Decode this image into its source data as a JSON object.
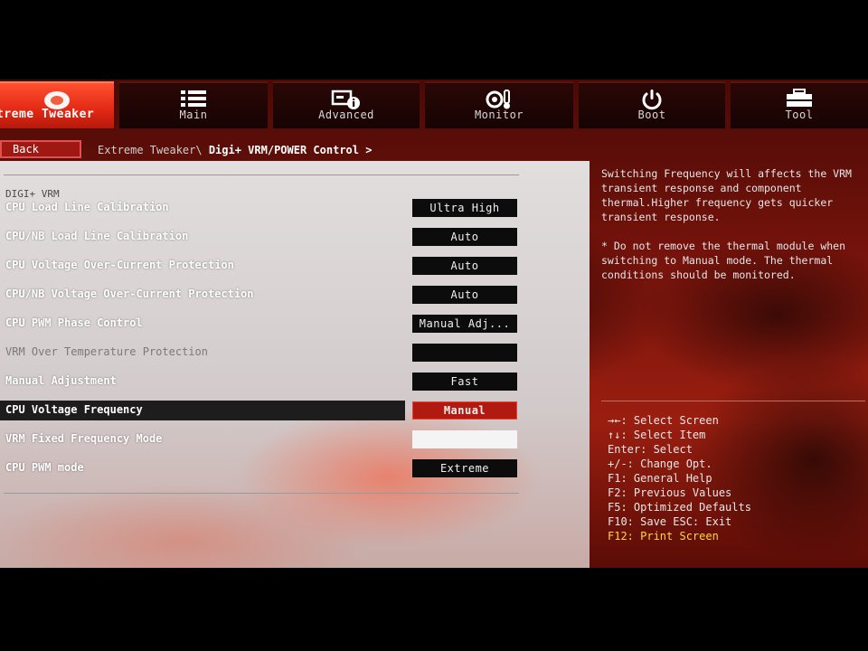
{
  "tabs": [
    {
      "label": "treme Tweaker",
      "icon": "gear-tweaker-icon",
      "active": true
    },
    {
      "label": "Main",
      "icon": "list-icon"
    },
    {
      "label": "Advanced",
      "icon": "advanced-info-icon"
    },
    {
      "label": "Monitor",
      "icon": "thermometer-gear-icon"
    },
    {
      "label": "Boot",
      "icon": "power-icon"
    },
    {
      "label": "Tool",
      "icon": "toolbox-icon"
    }
  ],
  "nav": {
    "back_label": "Back",
    "crumb_path": "Extreme Tweaker\\ ",
    "crumb_current": "Digi+ VRM/POWER Control >"
  },
  "section_title": "DIGI+ VRM",
  "settings": [
    {
      "label": "CPU Load Line Calibration",
      "value": "Ultra High"
    },
    {
      "label": "CPU/NB Load Line Calibration",
      "value": "Auto"
    },
    {
      "label": "CPU Voltage Over-Current Protection",
      "value": "Auto"
    },
    {
      "label": "CPU/NB Voltage Over-Current Protection",
      "value": "Auto"
    },
    {
      "label": "CPU PWM Phase Control",
      "value": "Manual Adj..."
    },
    {
      "label": "VRM Over Temperature Protection",
      "value": ""
    },
    {
      "label": "Manual Adjustment",
      "value": "Fast"
    },
    {
      "label": "CPU Voltage Frequency",
      "value": "Manual",
      "selected": true
    },
    {
      "label": "VRM Fixed Frequency Mode",
      "value": ""
    },
    {
      "label": "CPU PWM mode",
      "value": "Extreme"
    }
  ],
  "help": {
    "description": "Switching Frequency will affects the VRM transient response and component thermal.Higher frequency gets quicker transient response.",
    "note": "* Do not remove the thermal module when switching to Manual mode. The thermal conditions should be monitored."
  },
  "keys": [
    "→←: Select Screen",
    "↑↓: Select Item",
    "Enter: Select",
    "+/-: Change Opt.",
    "F1: General Help",
    "F2: Previous Values",
    "F5: Optimized Defaults",
    "F10: Save  ESC: Exit",
    "F12: Print Screen"
  ],
  "colors": {
    "accent": "#e22814",
    "selected_value": "#b01a10",
    "hotkey_highlight": "#ffd83a"
  }
}
